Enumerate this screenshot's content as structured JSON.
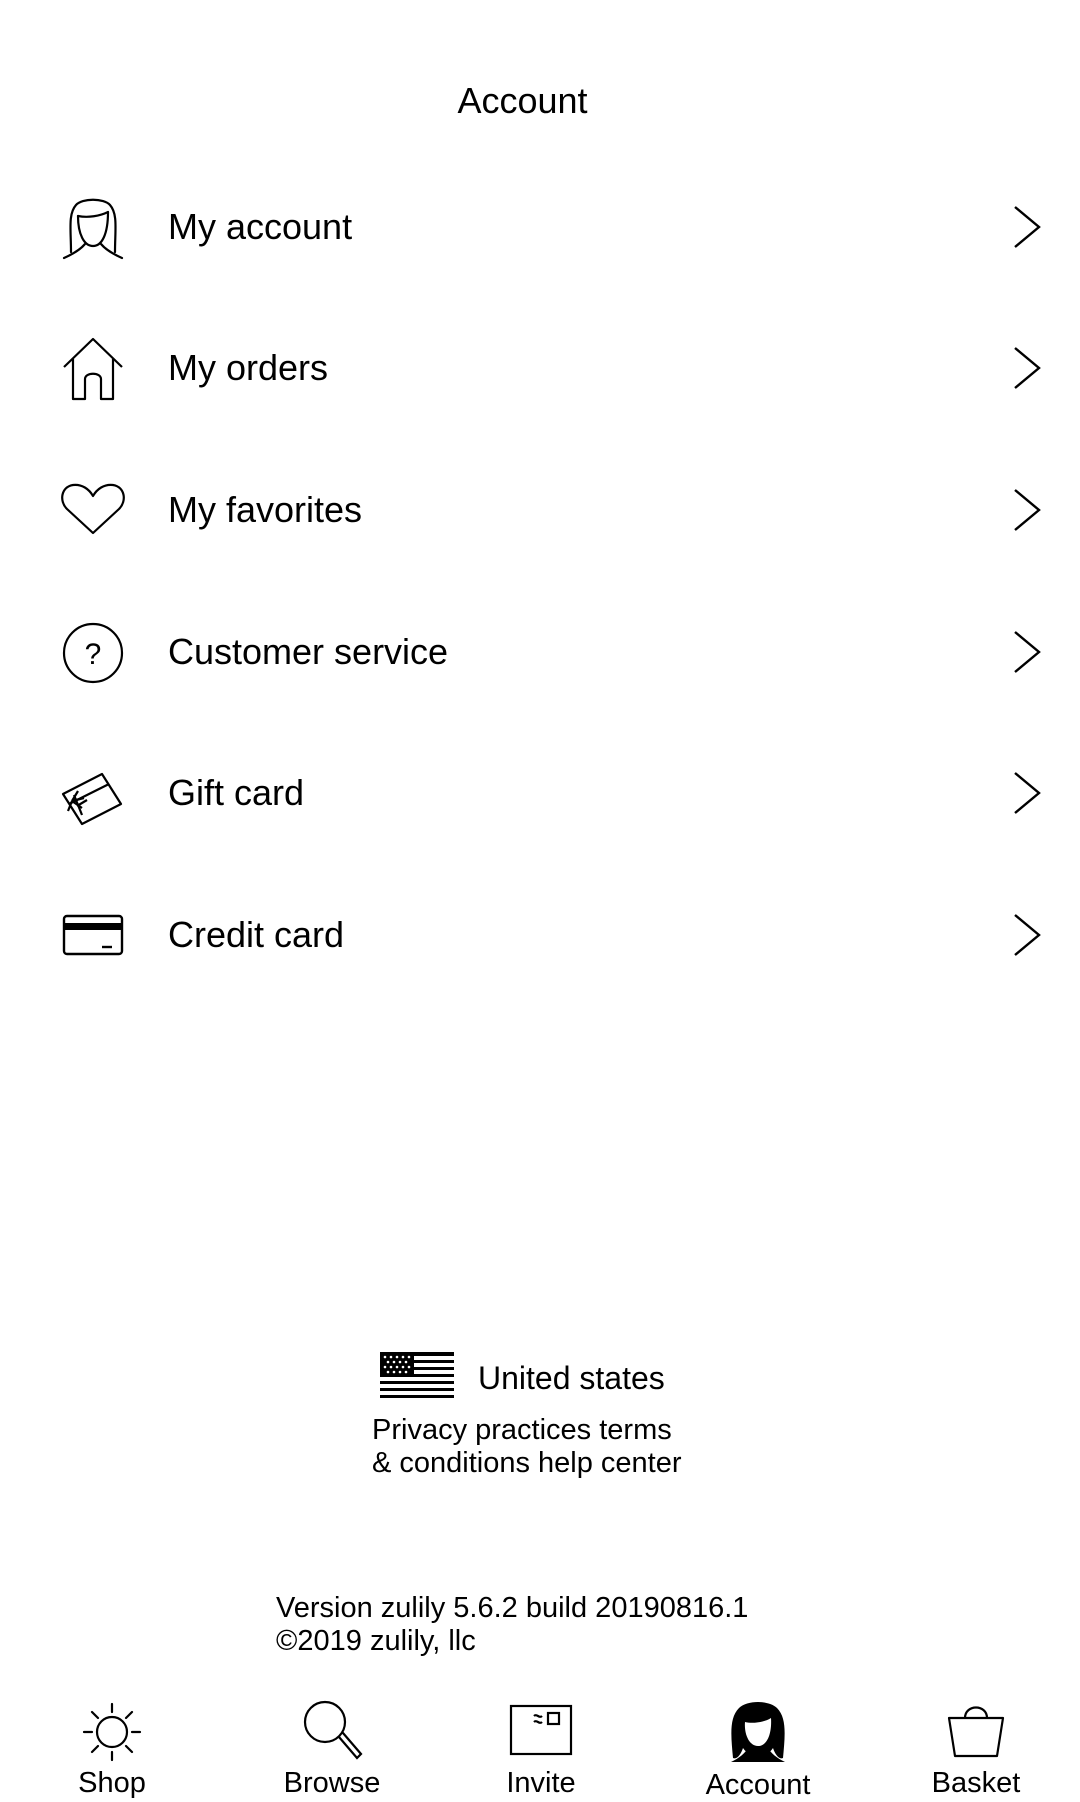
{
  "header": {
    "title": "Account"
  },
  "menu": {
    "items": [
      {
        "label": "My account",
        "icon": "woman-face-icon"
      },
      {
        "label": "My orders",
        "icon": "house-icon"
      },
      {
        "label": "My favorites",
        "icon": "heart-icon"
      },
      {
        "label": "Customer service",
        "icon": "question-circle-icon"
      },
      {
        "label": "Gift card",
        "icon": "gift-card-icon"
      },
      {
        "label": "Credit card",
        "icon": "credit-card-icon"
      }
    ],
    "chevron_icon": "chevron-right-icon"
  },
  "footer": {
    "country": {
      "flag_icon": "us-flag-icon",
      "name": "United states"
    },
    "links_line1": "Privacy practices terms",
    "links_line2": "& conditions help center",
    "version_line1": "Version zulily 5.6.2 build 20190816.1",
    "version_line2": "©2019 zulily, llc"
  },
  "tabbar": {
    "active_tab": "Account",
    "tabs": [
      {
        "label": "Shop",
        "icon": "sun-icon"
      },
      {
        "label": "Browse",
        "icon": "magnifier-icon"
      },
      {
        "label": "Invite",
        "icon": "envelope-icon"
      },
      {
        "label": "Account",
        "icon": "woman-silhouette-icon"
      },
      {
        "label": "Basket",
        "icon": "shopping-bag-icon"
      }
    ]
  },
  "colors": {
    "foreground": "#000000",
    "background": "#ffffff"
  }
}
